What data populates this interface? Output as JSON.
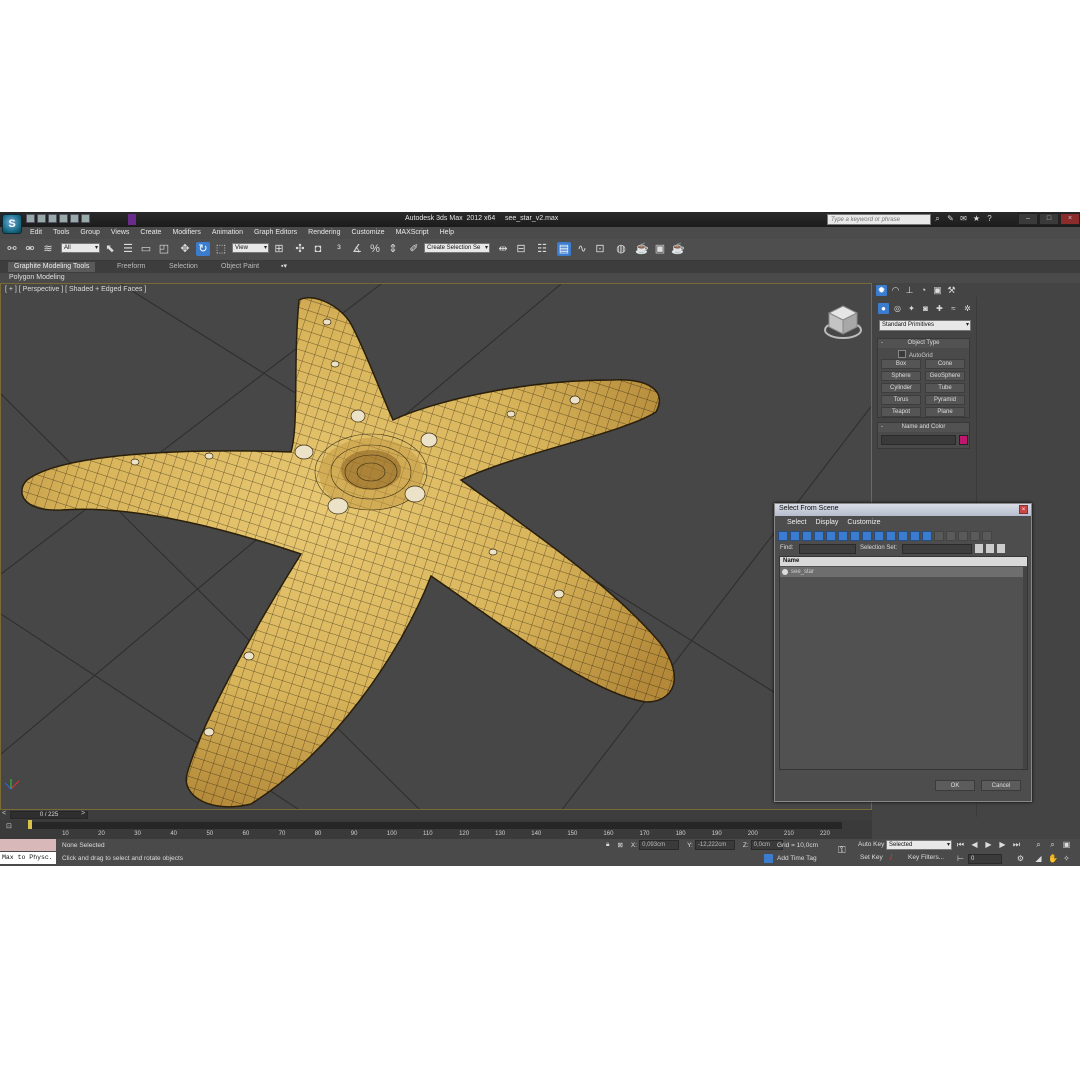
{
  "window": {
    "title": "Autodesk 3ds Max  2012 x64     see_star_v2.max",
    "search_placeholder": "Type a keyword or phrase"
  },
  "menubar": [
    "Edit",
    "Tools",
    "Group",
    "Views",
    "Create",
    "Modifiers",
    "Animation",
    "Graph Editors",
    "Rendering",
    "Customize",
    "MAXScript",
    "Help"
  ],
  "toolbar": {
    "selection_filter": "All",
    "ref_coord": "View",
    "named_selection": "Create Selection Se"
  },
  "ribbon": {
    "tabs": [
      "Graphite Modeling Tools",
      "Freeform",
      "Selection",
      "Object Paint"
    ],
    "panel_label": "Polygon Modeling"
  },
  "viewport": {
    "label": "[ + ] [ Perspective ] [ Shaded + Edged Faces ]",
    "object_color": "#d8b45a",
    "wire_color": "#1a1408"
  },
  "command_panel": {
    "category": "Standard Primitives",
    "object_type_title": "Object Type",
    "autogrid_label": "AutoGrid",
    "buttons": [
      "Box",
      "Cone",
      "Sphere",
      "GeoSphere",
      "Cylinder",
      "Tube",
      "Torus",
      "Pyramid",
      "Teapot",
      "Plane"
    ],
    "name_color_title": "Name and Color",
    "object_color": "#c0176e"
  },
  "dialog": {
    "title": "Select From Scene",
    "menus": [
      "Select",
      "Display",
      "Customize"
    ],
    "find_label": "Find:",
    "selection_set_label": "Selection Set:",
    "column_name": "Name",
    "items": [
      "see_star"
    ],
    "ok": "OK",
    "cancel": "Cancel"
  },
  "timeline": {
    "slider_label": "0 / 225",
    "current_frame": 0,
    "total_frames": 225,
    "ticks": [
      "10",
      "20",
      "30",
      "40",
      "50",
      "60",
      "70",
      "80",
      "90",
      "100",
      "110",
      "120",
      "130",
      "140",
      "150",
      "160",
      "170",
      "180",
      "190",
      "200",
      "210",
      "220"
    ]
  },
  "status": {
    "maxscript_listener": "Max to Physc.",
    "selection": "None Selected",
    "prompt": "Click and drag to select and rotate objects",
    "x_label": "X:",
    "x_value": "0,093cm",
    "y_label": "Y:",
    "y_value": "-12,222cm",
    "z_label": "Z:",
    "z_value": "0,0cm",
    "grid": "Grid = 10,0cm",
    "add_time_tag": "Add Time Tag",
    "auto_key": "Auto Key",
    "key_mode": "Selected",
    "set_key": "Set Key",
    "key_filters": "Key Filters...",
    "frame": "0"
  }
}
